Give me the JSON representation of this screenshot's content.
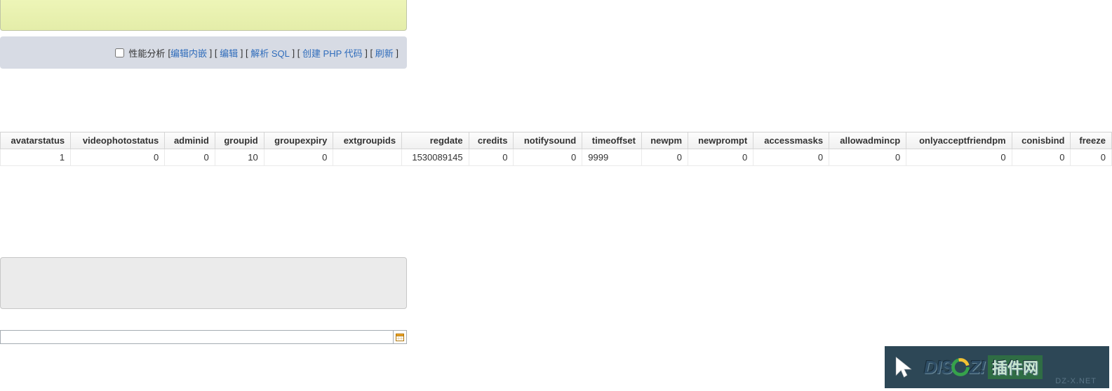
{
  "options": {
    "profiling_label": "性能分析",
    "links": [
      {
        "label": "编辑内嵌"
      },
      {
        "label": "编辑"
      },
      {
        "label": "解析 SQL"
      },
      {
        "label": "创建 PHP 代码"
      },
      {
        "label": "刷新"
      }
    ]
  },
  "table": {
    "columns": [
      "avatarstatus",
      "videophotostatus",
      "adminid",
      "groupid",
      "groupexpiry",
      "extgroupids",
      "regdate",
      "credits",
      "notifysound",
      "timeoffset",
      "newpm",
      "newprompt",
      "accessmasks",
      "allowadmincp",
      "onlyacceptfriendpm",
      "conisbind",
      "freeze"
    ],
    "row": {
      "avatarstatus": "1",
      "videophotostatus": "0",
      "adminid": "0",
      "groupid": "10",
      "groupexpiry": "0",
      "extgroupids": "",
      "regdate": "1530089145",
      "credits": "0",
      "notifysound": "0",
      "timeoffset": "9999",
      "newpm": "0",
      "newprompt": "0",
      "accessmasks": "0",
      "allowadmincp": "0",
      "onlyacceptfriendpm": "0",
      "conisbind": "0",
      "freeze": "0"
    },
    "left_align_cols": [
      "extgroupids",
      "timeoffset"
    ]
  },
  "input": {
    "value": ""
  },
  "watermark": {
    "cursor": "cursor-icon",
    "text_prefix": "DIS",
    "text_suffix": "Z!",
    "hanzi": "插件网",
    "sub": "DZ-X.NET"
  }
}
